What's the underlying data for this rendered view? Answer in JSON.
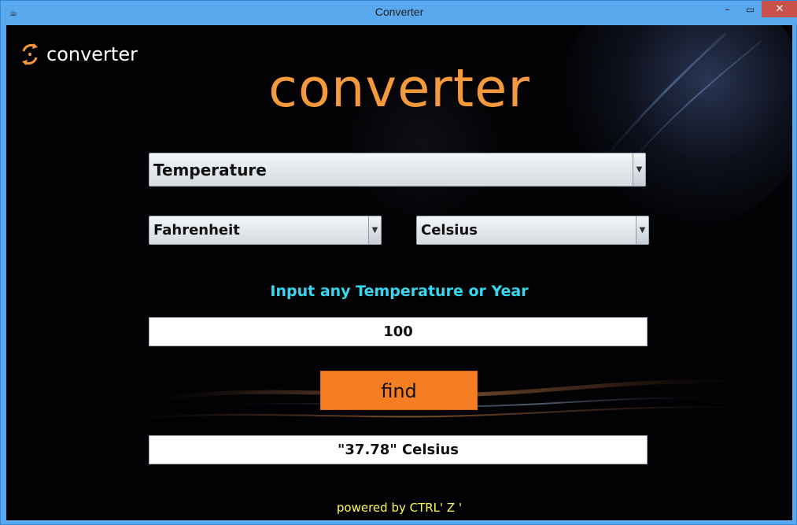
{
  "window": {
    "title": "Converter",
    "controls": {
      "minimize_glyph": "–",
      "maximize_glyph": "▭",
      "close_glyph": "✕"
    },
    "app_icon": "java-cup-icon"
  },
  "header": {
    "logo_icon": "refresh-cycle-icon",
    "logo_text": "converter",
    "main_title": "converter"
  },
  "form": {
    "category_select": {
      "value": "Temperature",
      "arrow_icon": "chevron-down-icon"
    },
    "from_select": {
      "value": "Fahrenheit",
      "arrow_icon": "chevron-down-icon"
    },
    "to_select": {
      "value": "Celsius",
      "arrow_icon": "chevron-down-icon"
    },
    "prompt": "Input any Temperature or Year",
    "input_value": "100",
    "button_label": "find",
    "result_value": "\"37.78\" Celsius"
  },
  "footer": {
    "text": "powered by CTRL' Z '"
  },
  "colors": {
    "accent": "#f59a3c",
    "button": "#f47e21",
    "prompt": "#37d7ef",
    "footer": "#ffff4a",
    "background": "#020204",
    "titlebar": "#5aa9ef",
    "close_button": "#c7514a"
  }
}
